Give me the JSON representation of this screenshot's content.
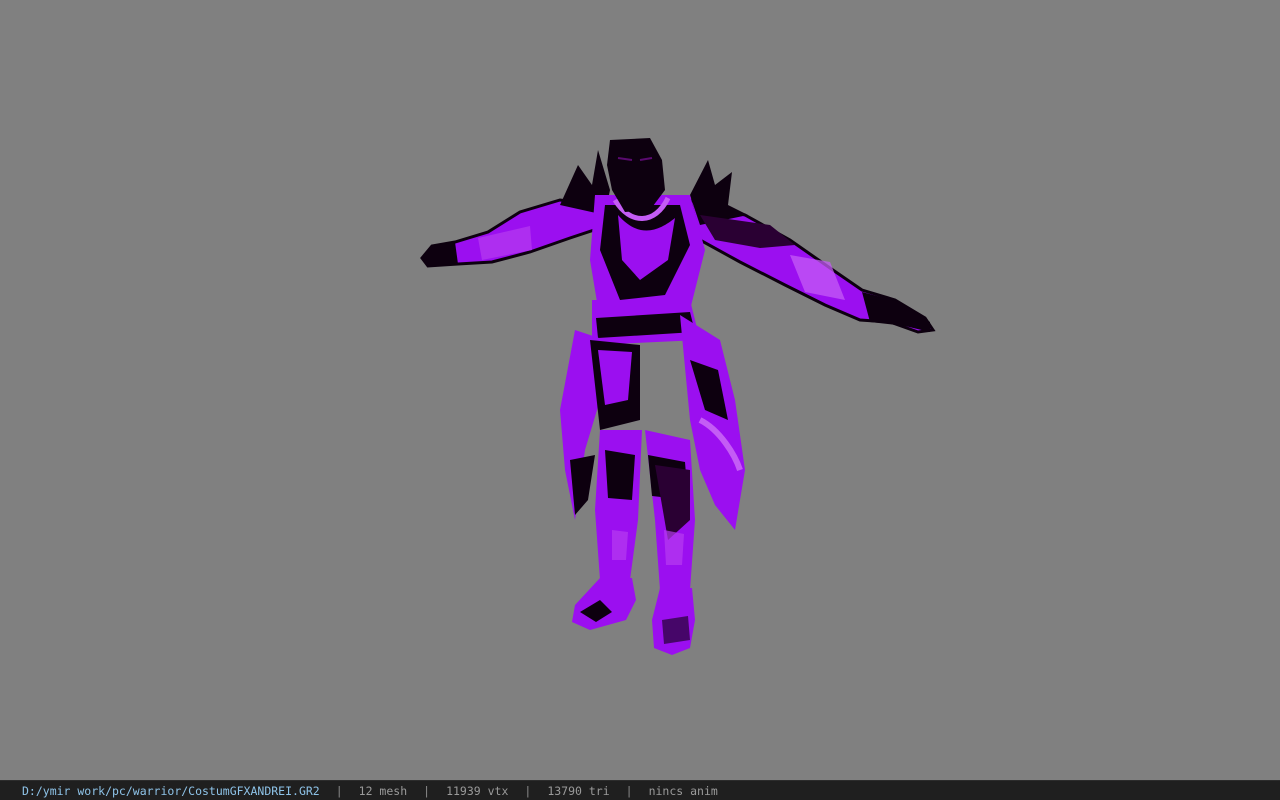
{
  "viewport": {
    "background": "#808080",
    "model_primary_color": "#9b0ff0",
    "model_dark_color": "#0d000f"
  },
  "status": {
    "file_path": "D:/ymir work/pc/warrior/CostumGFXANDREI.GR2",
    "separator": "|",
    "mesh": "12 mesh",
    "vtx": "11939 vtx",
    "tri": "13790 tri",
    "anim": "nincs anim"
  }
}
